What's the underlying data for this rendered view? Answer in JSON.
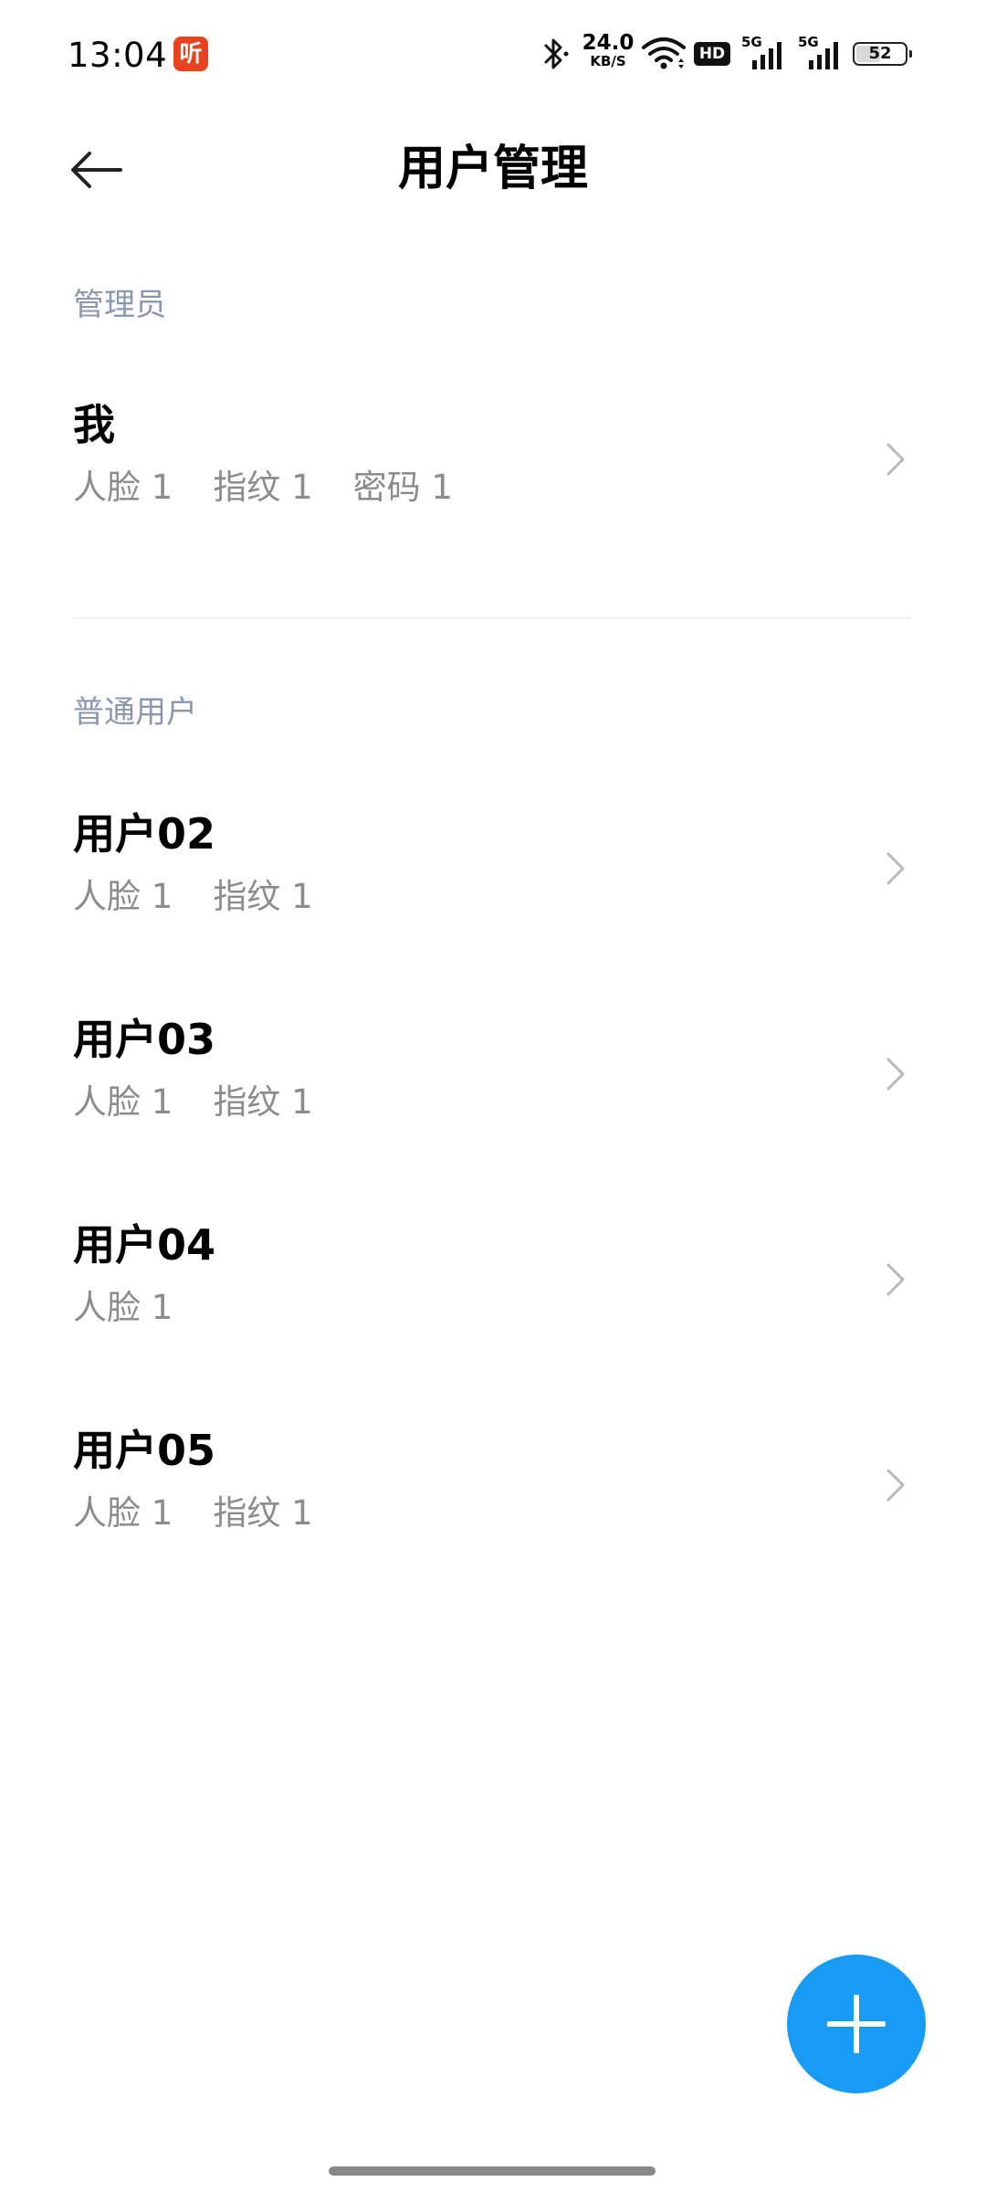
{
  "status_bar": {
    "time": "13:04",
    "app_badge": "听",
    "net_speed_value": "24.0",
    "net_speed_unit": "KB/S",
    "hd_label": "HD",
    "signal_1_label": "5G",
    "signal_2_label": "5G",
    "battery_level": "52",
    "icons": [
      "bluetooth-icon",
      "wifi-icon",
      "signal-icon",
      "battery-icon"
    ]
  },
  "header": {
    "title": "用户管理",
    "back_icon": "back-arrow-icon"
  },
  "sections": {
    "admin_label": "管理员",
    "normal_label": "普通用户"
  },
  "admin": {
    "name": "我",
    "creds": [
      "人脸 1",
      "指纹 1",
      "密码 1"
    ]
  },
  "users": [
    {
      "name": "用户02",
      "creds": [
        "人脸 1",
        "指纹 1"
      ]
    },
    {
      "name": "用户03",
      "creds": [
        "人脸 1",
        "指纹 1"
      ]
    },
    {
      "name": "用户04",
      "creds": [
        "人脸 1"
      ]
    },
    {
      "name": "用户05",
      "creds": [
        "人脸 1",
        "指纹 1"
      ]
    }
  ],
  "fab": {
    "icon": "plus-icon"
  },
  "colors": {
    "accent": "#179bf5",
    "section_label": "#8a97ad",
    "secondary_text": "#8c8c8c",
    "app_badge": "#e8431f"
  }
}
